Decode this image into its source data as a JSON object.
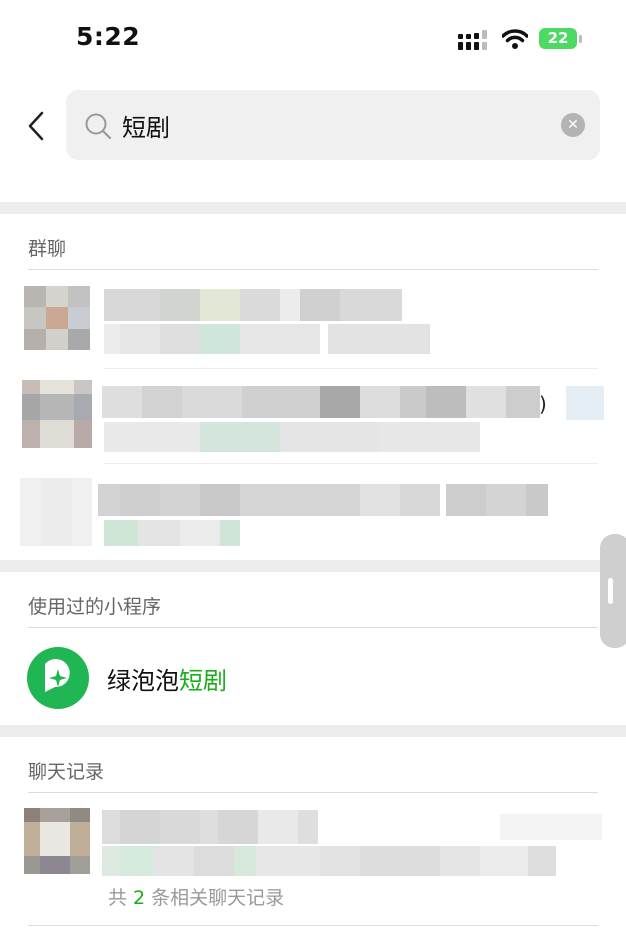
{
  "status_bar": {
    "time": "5:22",
    "battery": "22"
  },
  "search": {
    "query": "短剧",
    "clear_icon": "clear-icon"
  },
  "sections": {
    "group_chats": {
      "title": "群聊"
    },
    "mini_programs": {
      "title": "使用过的小程序",
      "item": {
        "name_prefix": "绿泡泡",
        "name_highlight": "短剧"
      }
    },
    "chat_history": {
      "title": "聊天记录",
      "summary_prefix": "共 ",
      "summary_count": "2",
      "summary_suffix": " 条相关聊天记录"
    }
  },
  "colors": {
    "accent": "#1aad19",
    "miniapp_icon": "#1fb653",
    "divider": "#ededed"
  }
}
